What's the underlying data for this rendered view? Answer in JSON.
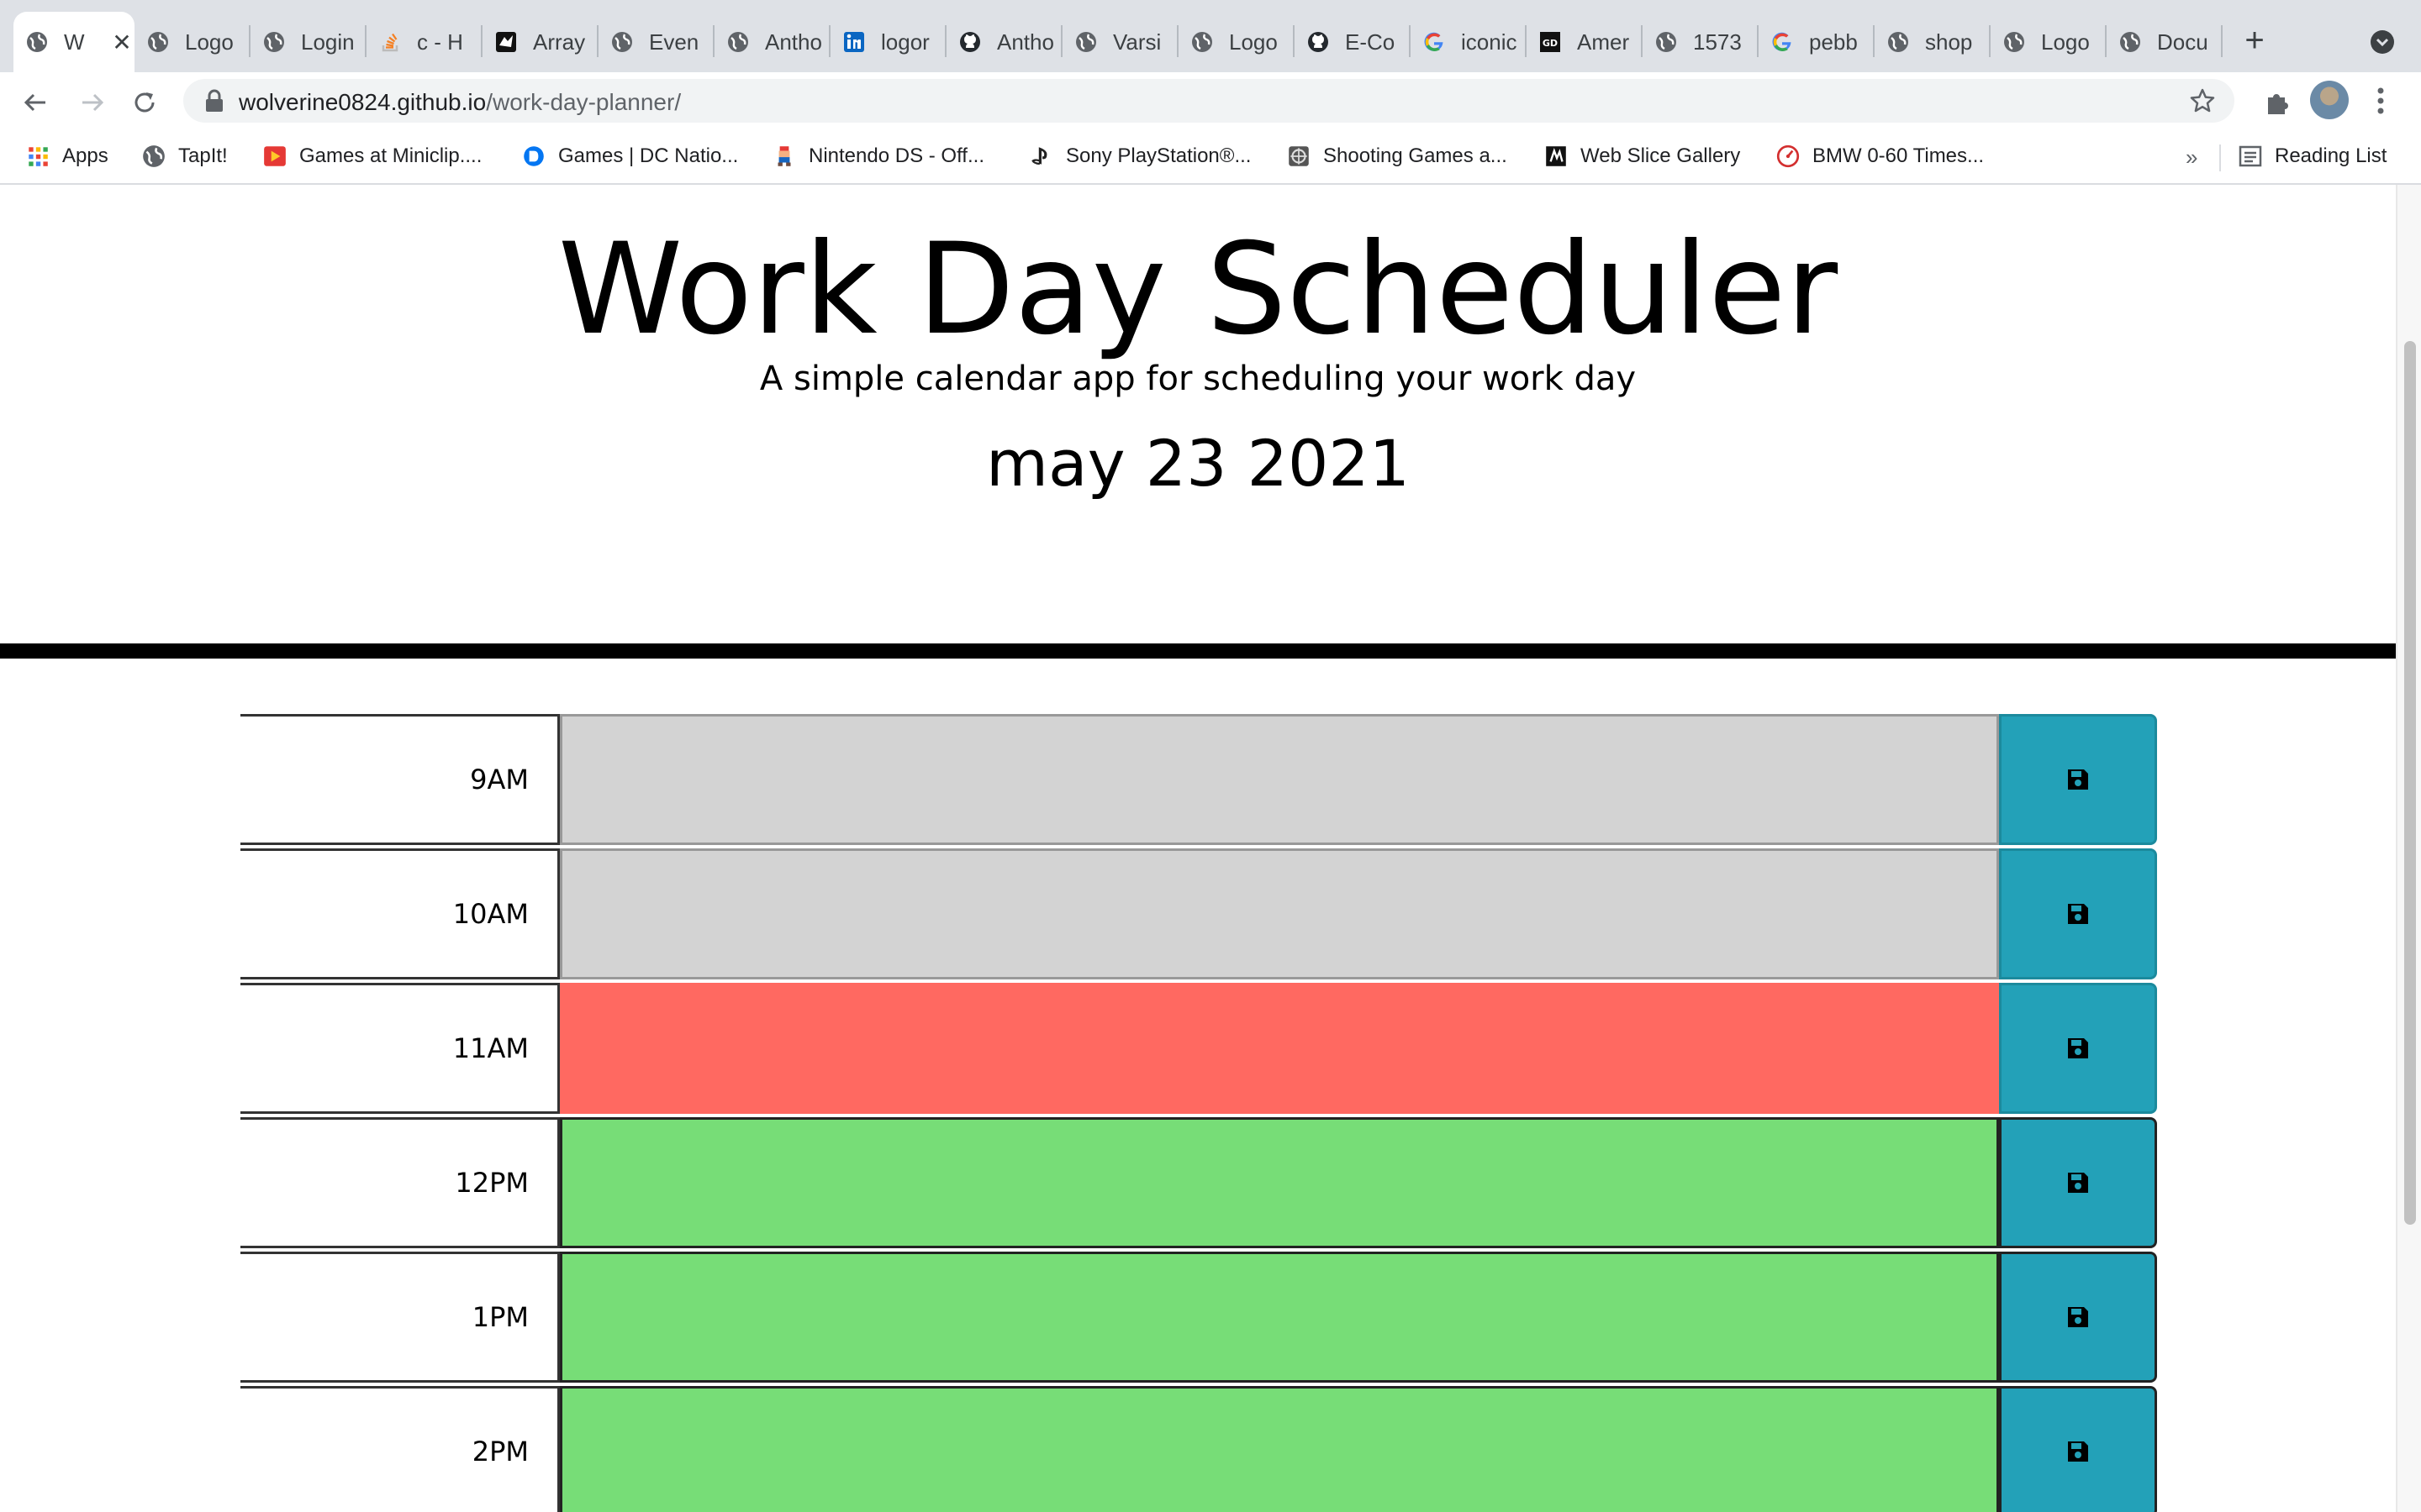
{
  "browser": {
    "tabs": [
      {
        "title": "W",
        "active": true,
        "icon": "globe-icon"
      },
      {
        "title": "Logo",
        "icon": "globe-icon"
      },
      {
        "title": "Login",
        "icon": "globe-icon"
      },
      {
        "title": "c - H",
        "icon": "stackoverflow-icon"
      },
      {
        "title": "Array",
        "icon": "codewars-icon"
      },
      {
        "title": "Even",
        "icon": "globe-icon"
      },
      {
        "title": "Antho",
        "icon": "globe-icon"
      },
      {
        "title": "logor",
        "icon": "linkedin-icon"
      },
      {
        "title": "Antho",
        "icon": "github-icon"
      },
      {
        "title": "Varsi",
        "icon": "globe-icon"
      },
      {
        "title": "Logo",
        "icon": "globe-icon"
      },
      {
        "title": "E-Co",
        "icon": "github-icon"
      },
      {
        "title": "iconic",
        "icon": "google-icon"
      },
      {
        "title": "Amer",
        "icon": "gd-icon"
      },
      {
        "title": "1573",
        "icon": "globe-icon"
      },
      {
        "title": "pebb",
        "icon": "google-icon"
      },
      {
        "title": "shop",
        "icon": "globe-icon"
      },
      {
        "title": "Logo",
        "icon": "globe-icon"
      },
      {
        "title": "Docu",
        "icon": "globe-icon"
      }
    ],
    "url": {
      "host": "wolverine0824.github.io",
      "path": "/work-day-planner/"
    },
    "bookmarks": [
      {
        "label": "Apps",
        "icon": "apps-grid-icon"
      },
      {
        "label": "TapIt!",
        "icon": "globe-icon"
      },
      {
        "label": "Games at Miniclip....",
        "icon": "miniclip-icon"
      },
      {
        "label": "Games | DC Natio...",
        "icon": "dc-icon"
      },
      {
        "label": "Nintendo DS - Off...",
        "icon": "mario-icon"
      },
      {
        "label": "Sony PlayStation®...",
        "icon": "playstation-icon"
      },
      {
        "label": "Shooting Games a...",
        "icon": "shooting-icon"
      },
      {
        "label": "Web Slice Gallery",
        "icon": "webslice-icon"
      },
      {
        "label": "BMW 0-60 Times...",
        "icon": "speedometer-icon"
      }
    ],
    "reading_list": "Reading List",
    "more": "»"
  },
  "header": {
    "title": "Work Day Scheduler",
    "subtitle": "A simple calendar app for scheduling your work day",
    "date": "may 23 2021"
  },
  "time_blocks": [
    {
      "hour": "9AM",
      "state": "past",
      "text": ""
    },
    {
      "hour": "10AM",
      "state": "past",
      "text": ""
    },
    {
      "hour": "11AM",
      "state": "present",
      "text": ""
    },
    {
      "hour": "12PM",
      "state": "future",
      "text": ""
    },
    {
      "hour": "1PM",
      "state": "future",
      "text": ""
    },
    {
      "hour": "2PM",
      "state": "future",
      "text": ""
    }
  ],
  "colors": {
    "past": "#d3d3d3",
    "present": "#ff6961",
    "future": "#77dd77",
    "save": "#23a1b8",
    "divider": "#000000"
  }
}
